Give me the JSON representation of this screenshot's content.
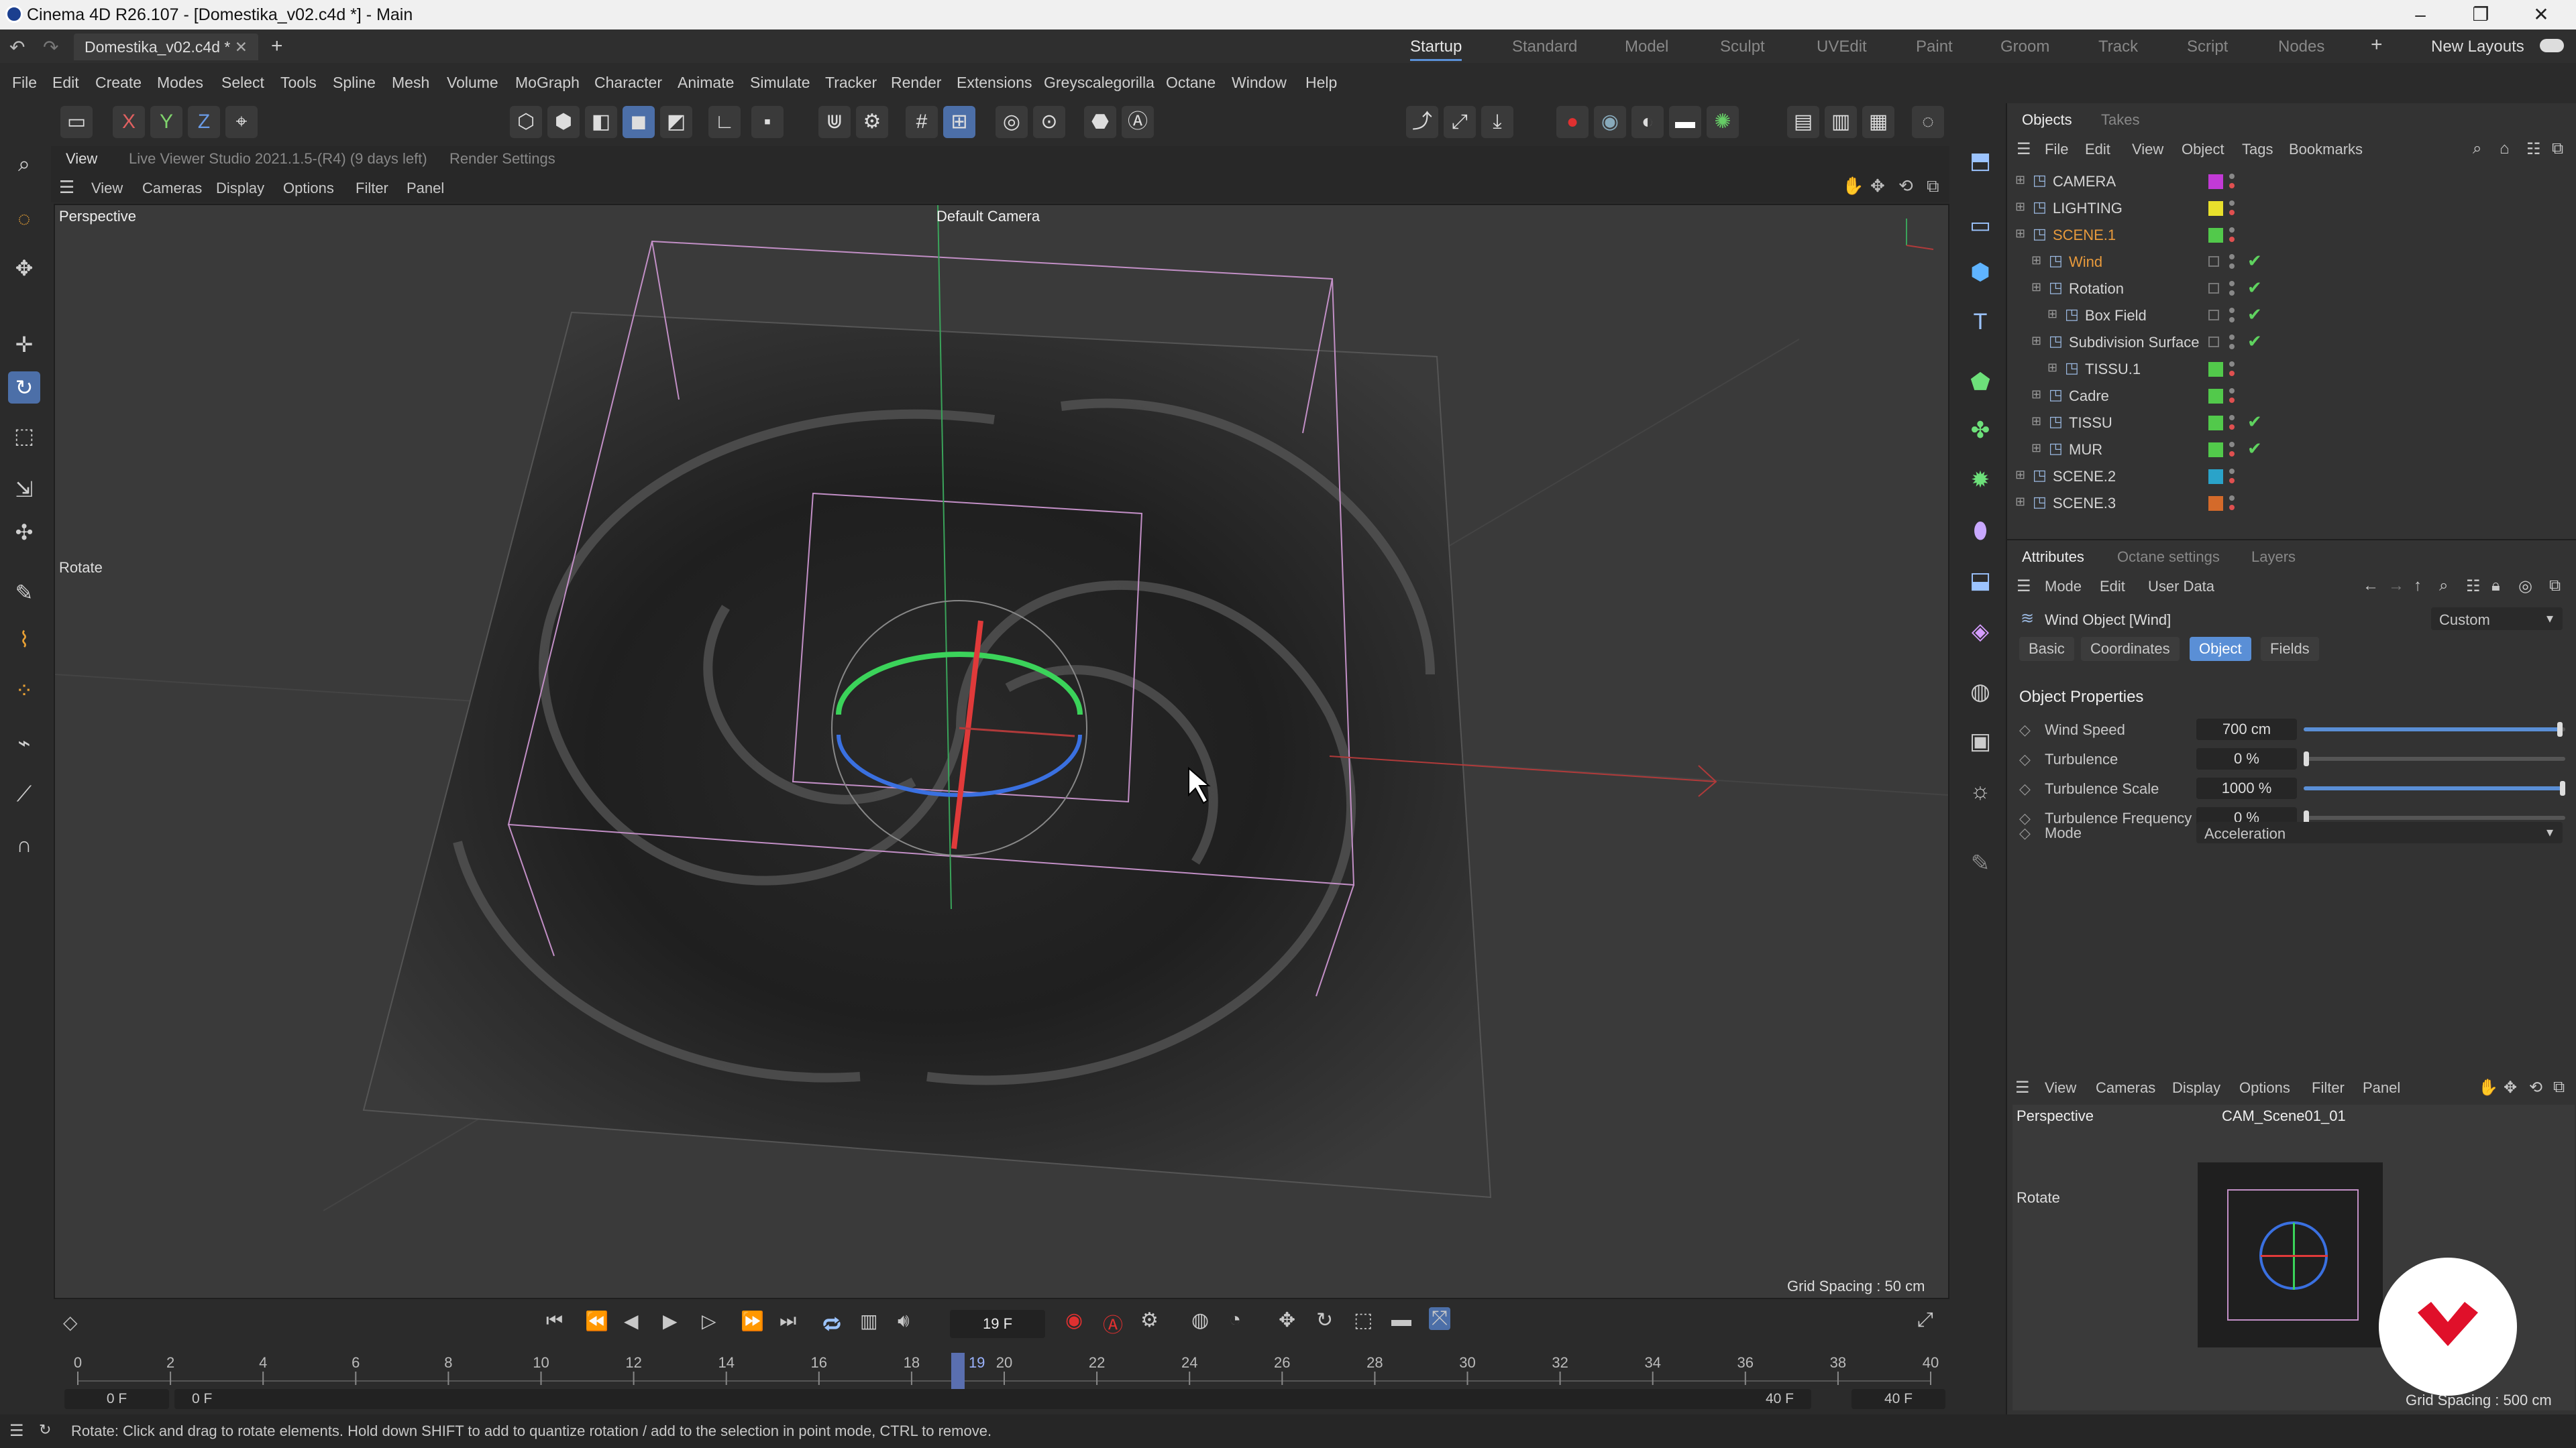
{
  "titlebar": {
    "title": "Cinema 4D R26.107 - [Domestika_v02.c4d *] - Main",
    "minimize": "–",
    "maximize": "❐",
    "close": "✕"
  },
  "tabs": {
    "document": "Domestika_v02.c4d *",
    "add": "+",
    "layouts": [
      "Startup",
      "Standard",
      "Model",
      "Sculpt",
      "UVEdit",
      "Paint",
      "Groom",
      "Track",
      "Script",
      "Nodes"
    ],
    "active_layout": "Startup",
    "new_layouts": "New Layouts"
  },
  "menu": [
    "File",
    "Edit",
    "Create",
    "Modes",
    "Select",
    "Tools",
    "Spline",
    "Mesh",
    "Volume",
    "MoGraph",
    "Character",
    "Animate",
    "Simulate",
    "Tracker",
    "Render",
    "Extensions",
    "Greyscalegorilla",
    "Octane",
    "Window",
    "Help"
  ],
  "axis_toggles": [
    "X",
    "Y",
    "Z"
  ],
  "viewport": {
    "header_tab": "View",
    "live_viewer": "Live Viewer Studio 2021.1.5-(R4) (9 days left)",
    "render_settings": "Render Settings",
    "menu": [
      "View",
      "Cameras",
      "Display",
      "Options",
      "Filter",
      "Panel"
    ],
    "label": "Perspective",
    "camera": "Default Camera",
    "tool_hint": "Rotate",
    "grid_spacing": "Grid Spacing : 50 cm"
  },
  "objects_panel": {
    "tabs": [
      "Objects",
      "Takes"
    ],
    "menu": [
      "File",
      "Edit",
      "View",
      "Object",
      "Tags",
      "Bookmarks"
    ],
    "items": [
      {
        "name": "CAMERA",
        "color": "#c23ad6",
        "indent": 0,
        "check": false,
        "highlight": false
      },
      {
        "name": "LIGHTING",
        "color": "#e8e02c",
        "indent": 0,
        "check": false,
        "highlight": false
      },
      {
        "name": "SCENE.1",
        "color": "#52c94b",
        "indent": 0,
        "check": false,
        "highlight": true
      },
      {
        "name": "Wind",
        "color": "",
        "indent": 1,
        "check": true,
        "highlight": true
      },
      {
        "name": "Rotation",
        "color": "",
        "indent": 1,
        "check": true,
        "highlight": false
      },
      {
        "name": "Box Field",
        "color": "",
        "indent": 2,
        "check": true,
        "highlight": false
      },
      {
        "name": "Subdivision Surface",
        "color": "",
        "indent": 1,
        "check": true,
        "highlight": false
      },
      {
        "name": "TISSU.1",
        "color": "#52c94b",
        "indent": 2,
        "check": false,
        "highlight": false
      },
      {
        "name": "Cadre",
        "color": "#52c94b",
        "indent": 1,
        "check": false,
        "highlight": false
      },
      {
        "name": "TISSU",
        "color": "#52c94b",
        "indent": 1,
        "check": true,
        "highlight": false
      },
      {
        "name": "MUR",
        "color": "#52c94b",
        "indent": 1,
        "check": true,
        "highlight": false
      },
      {
        "name": "SCENE.2",
        "color": "#2aa3c9",
        "indent": 0,
        "check": false,
        "highlight": false
      },
      {
        "name": "SCENE.3",
        "color": "#d46a2a",
        "indent": 0,
        "check": false,
        "highlight": false
      }
    ]
  },
  "attributes": {
    "tabs": [
      "Attributes",
      "Octane settings",
      "Layers"
    ],
    "menu": [
      "Mode",
      "Edit",
      "User Data"
    ],
    "object_title": "Wind Object [Wind]",
    "preset": "Custom",
    "subtabs": [
      "Basic",
      "Coordinates",
      "Object",
      "Fields"
    ],
    "active_subtab": "Object",
    "section": "Object Properties",
    "props": [
      {
        "label": "Wind Speed",
        "value": "700 cm",
        "slider": 0.99
      },
      {
        "label": "Turbulence",
        "value": "0 %",
        "slider": 0.0
      },
      {
        "label": "Turbulence Scale",
        "value": "1000 %",
        "slider": 1.0
      },
      {
        "label": "Turbulence Frequency",
        "value": "0 %",
        "slider": 0.0
      }
    ],
    "mode_label": "Mode",
    "mode_value": "Acceleration"
  },
  "small_viewport": {
    "menu": [
      "View",
      "Cameras",
      "Display",
      "Options",
      "Filter",
      "Panel"
    ],
    "label": "Perspective",
    "camera": "CAM_Scene01_01",
    "tool_hint": "Rotate",
    "grid_spacing": "Grid Spacing : 500 cm"
  },
  "timeline": {
    "current_frame": "19 F",
    "start_field": "0 F",
    "start_field2": "0 F",
    "end_field": "40 F",
    "end_field2": "40 F",
    "ticks": [
      "0",
      "2",
      "4",
      "6",
      "8",
      "10",
      "12",
      "14",
      "16",
      "18",
      "20",
      "22",
      "24",
      "26",
      "28",
      "30",
      "32",
      "34",
      "36",
      "38",
      "40"
    ],
    "marker": "19",
    "marker_frame": 19,
    "total_frames": 40
  },
  "status": {
    "text": "Rotate: Click and drag to rotate elements. Hold down SHIFT to add to quantize rotation / add to the selection in point mode, CTRL to remove."
  },
  "colors": {
    "accent": "#5a8fd6",
    "record": "#e03030",
    "brand": "#e0102a"
  }
}
